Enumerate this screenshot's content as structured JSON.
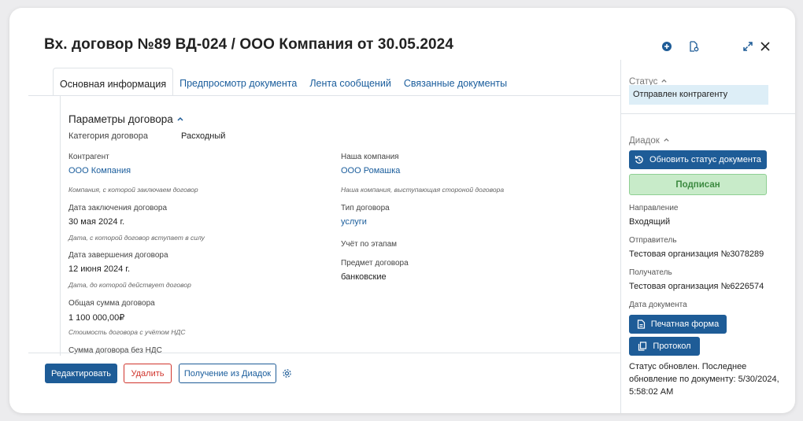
{
  "header": {
    "title": "Вх. договор №89 ВД-024 / ООО Компания от 30.05.2024"
  },
  "tabs": [
    {
      "label": "Основная информация",
      "active": true
    },
    {
      "label": "Предпросмотр документа",
      "active": false
    },
    {
      "label": "Лента сообщений",
      "active": false
    },
    {
      "label": "Связанные документы",
      "active": false
    }
  ],
  "params": {
    "section_title": "Параметры договора",
    "category_label": "Категория договора",
    "category_value": "Расходный",
    "counterparty_label": "Контрагент",
    "counterparty_value": "ООО Компания",
    "counterparty_hint": "Компания, с которой заключаем договор",
    "our_company_label": "Наша компания",
    "our_company_value": "ООО Ромашка",
    "our_company_hint": "Наша компания, выступающая стороной договора",
    "conclusion_date_label": "Дата заключения договора",
    "conclusion_date_value": "30 мая 2024 г.",
    "conclusion_date_hint": "Дата, с которой договор вступает в силу",
    "contract_type_label": "Тип договора",
    "contract_type_value": "услуги",
    "stages_label": "Учёт по этапам",
    "end_date_label": "Дата завершения договора",
    "end_date_value": "12 июня 2024 г.",
    "end_date_hint": "Дата, до которой действует договор",
    "subject_label": "Предмет договора",
    "subject_value": "банковские",
    "total_label": "Общая сумма договора",
    "total_value": "1 100 000,00₽",
    "total_hint": "Стоимость договора с учётом НДС",
    "no_vat_label": "Сумма договора без НДС"
  },
  "footer": {
    "edit_label": "Редактировать",
    "delete_label": "Удалить",
    "diadoc_label": "Получение из Диадок"
  },
  "side": {
    "status_title": "Статус",
    "status_value": "Отправлен контрагенту",
    "diadoc_title": "Диадок",
    "refresh_label": "Обновить статус документа",
    "signed_label": "Подписан",
    "direction_label": "Направление",
    "direction_value": "Входящий",
    "sender_label": "Отправитель",
    "sender_value": "Тестовая организация №3078289",
    "recipient_label": "Получатель",
    "recipient_value": "Тестовая организация №6226574",
    "doc_date_label": "Дата документа",
    "print_label": "Печатная форма",
    "protocol_label": "Протокол",
    "status_text": "Статус обновлен. Последнее обновление по документу: 5/30/2024, 5:58:02 AM"
  },
  "colors": {
    "primary": "#1e5c97",
    "link": "#1a5d9c",
    "danger": "#d0342c",
    "status_bg": "#ddeef7",
    "signed_bg": "#c8ebc9",
    "signed_text": "#3c8a40"
  },
  "icons": [
    "add-circle-icon",
    "document-settings-icon",
    "expand-icon",
    "close-icon",
    "chevron-up-icon",
    "refresh-icon",
    "document-icon",
    "copy-icon",
    "gear-icon"
  ]
}
